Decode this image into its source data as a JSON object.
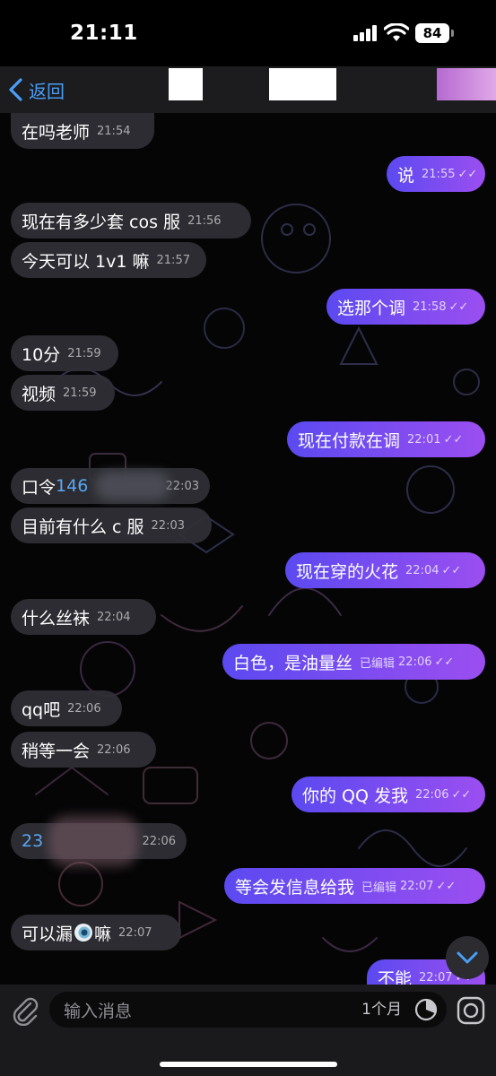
{
  "status_bar": {
    "time": "21:11",
    "battery": "84"
  },
  "nav": {
    "back_label": "返回"
  },
  "messages": [
    {
      "side": "in",
      "text": "在吗老师",
      "time": "21:54"
    },
    {
      "side": "out",
      "text": "说",
      "time": "21:55"
    },
    {
      "side": "in",
      "text": "现在有多少套 cos 服",
      "time": "21:56"
    },
    {
      "side": "in",
      "text": "今天可以 1v1 嘛",
      "time": "21:57"
    },
    {
      "side": "out",
      "text": "选那个调",
      "time": "21:58"
    },
    {
      "side": "in",
      "text": "10分",
      "time": "21:59"
    },
    {
      "side": "in",
      "text": "视频",
      "time": "21:59"
    },
    {
      "side": "out",
      "text": "现在付款在调",
      "time": "22:01"
    },
    {
      "side": "in",
      "text": "口令 ",
      "link": "146",
      "time": "22:03"
    },
    {
      "side": "in",
      "text": "目前有什么 c 服",
      "time": "22:03"
    },
    {
      "side": "out",
      "text": "现在穿的火花",
      "time": "22:04"
    },
    {
      "side": "in",
      "text": "什么丝袜",
      "time": "22:04"
    },
    {
      "side": "out",
      "text": "白色，是油量丝",
      "edited": "已编辑",
      "time": "22:06"
    },
    {
      "side": "in",
      "text": "qq吧",
      "time": "22:06"
    },
    {
      "side": "in",
      "text": "稍等一会",
      "time": "22:06"
    },
    {
      "side": "out",
      "text": "你的 QQ 发我",
      "time": "22:06"
    },
    {
      "side": "in",
      "text": "",
      "link": "23",
      "time": "22:06"
    },
    {
      "side": "out",
      "text": "等会发信息给我",
      "edited": "已编辑",
      "time": "22:07"
    },
    {
      "side": "in",
      "text": "可以漏",
      "text_after": "嘛",
      "time": "22:07"
    },
    {
      "side": "out",
      "text": "不能",
      "time": "22:07"
    }
  ],
  "input": {
    "placeholder": "输入消息",
    "timer": "1个月"
  },
  "icons": [
    "chevron-left-icon",
    "attach-icon",
    "timer-icon",
    "camera-icon",
    "scroll-down-icon",
    "read-ticks-icon"
  ],
  "colors": {
    "accent": "#4a9ef7",
    "outgoing_start": "#5b4af0",
    "outgoing_end": "#9b4ef0"
  }
}
